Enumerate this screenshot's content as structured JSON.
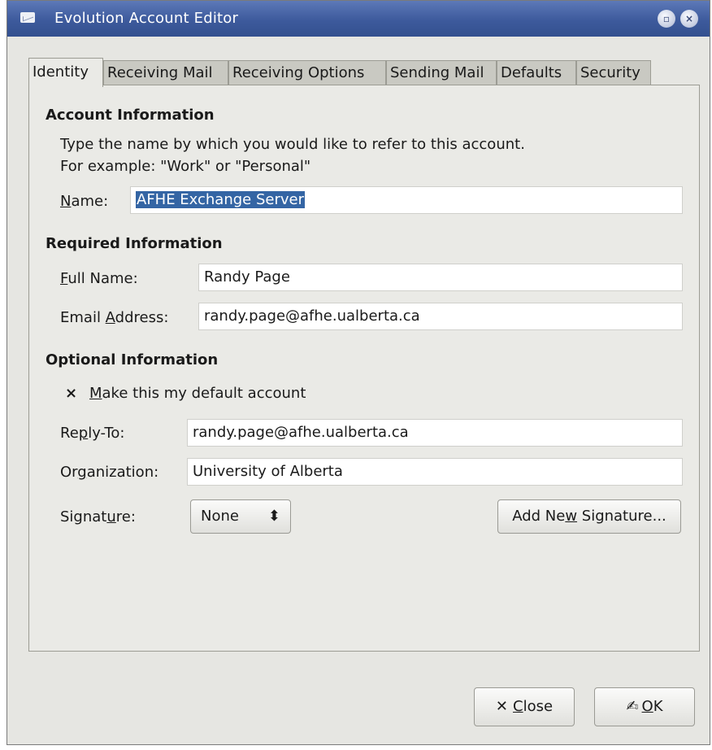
{
  "window": {
    "title": "Evolution Account Editor"
  },
  "tabs": [
    {
      "label": "Identity"
    },
    {
      "label": "Receiving Mail"
    },
    {
      "label": "Receiving Options"
    },
    {
      "label": "Sending Mail"
    },
    {
      "label": "Defaults"
    },
    {
      "label": "Security"
    }
  ],
  "account_info": {
    "heading": "Account Information",
    "desc_line1": "Type the name by which you would like to refer to this account.",
    "desc_line2": "For example: \"Work\" or \"Personal\"",
    "name_label_u": "N",
    "name_label_rest": "ame:",
    "name_value": "AFHE Exchange Server"
  },
  "required_info": {
    "heading": "Required Information",
    "fullname_label_u": "F",
    "fullname_label_rest": "ull Name:",
    "fullname_value": "Randy Page",
    "email_label_pre": "Email ",
    "email_label_u": "A",
    "email_label_rest": "ddress:",
    "email_value": "randy.page@afhe.ualberta.ca"
  },
  "optional_info": {
    "heading": "Optional Information",
    "default_check_mark": "×",
    "default_label_u": "M",
    "default_label_rest": "ake this my default account",
    "default_checked": true,
    "replyto_label_pre": "Re",
    "replyto_label_u": "p",
    "replyto_label_rest": "ly-To:",
    "replyto_value": "randy.page@afhe.ualberta.ca",
    "org_label_pre": "Or",
    "org_label_u": "g",
    "org_label_rest": "anization:",
    "org_value": "University of Alberta",
    "sig_label_pre": "Signat",
    "sig_label_u": "u",
    "sig_label_rest": "re:",
    "sig_value": "None",
    "sig_arrows": "⬍",
    "add_sig_pre": "Add Ne",
    "add_sig_u": "w",
    "add_sig_rest": " Signature..."
  },
  "buttons": {
    "close_icon": "✕",
    "close_u": "C",
    "close_rest": "lose",
    "ok_icon": "✍",
    "ok_u": "O",
    "ok_rest": "K"
  },
  "colors": {
    "titlebar": "#3d5a9c",
    "selection": "#3465a4",
    "panel": "#eaeae6"
  }
}
